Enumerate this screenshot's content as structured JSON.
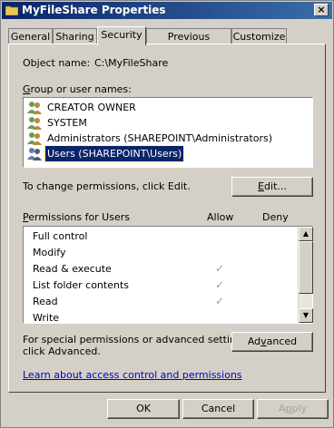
{
  "window": {
    "title": "MyFileShare Properties",
    "close_glyph": "×"
  },
  "tabs": [
    {
      "label": "General",
      "active": false
    },
    {
      "label": "Sharing",
      "active": false
    },
    {
      "label": "Security",
      "active": true
    },
    {
      "label": "Previous Versions",
      "active": false
    },
    {
      "label": "Customize",
      "active": false
    }
  ],
  "object": {
    "label": "Object name:",
    "value": "C:\\MyFileShare"
  },
  "groups": {
    "label": "Group or user names:",
    "items": [
      {
        "name": "CREATOR OWNER",
        "icon": "user-group-icon",
        "selected": false
      },
      {
        "name": "SYSTEM",
        "icon": "user-group-icon",
        "selected": false
      },
      {
        "name": "Administrators (SHAREPOINT\\Administrators)",
        "icon": "user-group-icon",
        "selected": false
      },
      {
        "name": "Users (SHAREPOINT\\Users)",
        "icon": "user-group-icon",
        "selected": true
      }
    ]
  },
  "change_hint": "To change permissions, click Edit.",
  "edit_button": "Edit...",
  "permissions": {
    "label": "Permissions for Users",
    "allow_label": "Allow",
    "deny_label": "Deny",
    "rows": [
      {
        "name": "Full control",
        "allow": false,
        "deny": false
      },
      {
        "name": "Modify",
        "allow": false,
        "deny": false
      },
      {
        "name": "Read & execute",
        "allow": true,
        "deny": false
      },
      {
        "name": "List folder contents",
        "allow": true,
        "deny": false
      },
      {
        "name": "Read",
        "allow": true,
        "deny": false
      },
      {
        "name": "Write",
        "allow": false,
        "deny": false
      }
    ]
  },
  "special_hint_line1": "For special permissions or advanced settings,",
  "special_hint_line2": "click Advanced.",
  "advanced_button": "Advanced",
  "learn_link": "Learn about access control and permissions",
  "footer": {
    "ok": "OK",
    "cancel": "Cancel",
    "apply": "Apply"
  },
  "colors": {
    "title_bar": "#0a246a",
    "selection": "#0a246a",
    "link": "#0000cc",
    "face": "#d4d0c8"
  }
}
